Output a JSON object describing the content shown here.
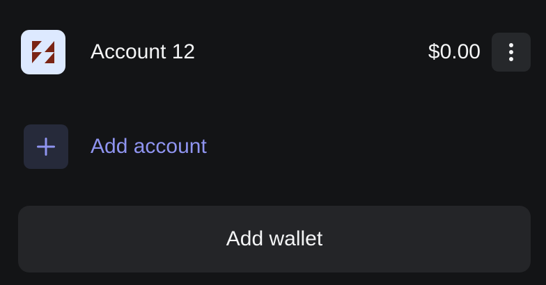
{
  "account": {
    "avatar_icon": "hourglass-logo-icon",
    "name": "Account 12",
    "balance": "$0.00",
    "more_icon": "vertical-dots-icon"
  },
  "add_account": {
    "icon": "plus-icon",
    "label": "Add account"
  },
  "add_wallet": {
    "label": "Add wallet"
  },
  "colors": {
    "background": "#131416",
    "accent": "#8f94f0",
    "avatar_bg": "#dde9ff",
    "logo": "#7a2414"
  }
}
